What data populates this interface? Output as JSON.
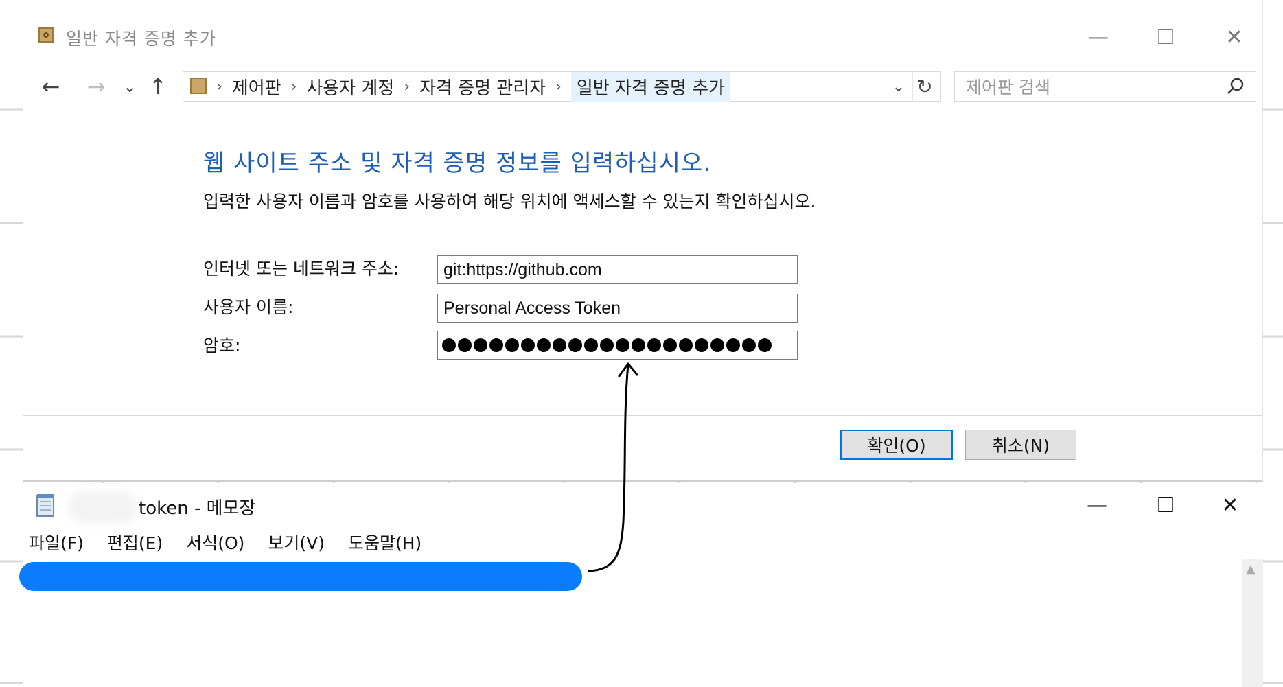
{
  "dialog": {
    "title": "일반 자격 증명 추가",
    "window_controls": {
      "minimize": "—",
      "maximize": "☐",
      "close": "✕"
    },
    "nav": {
      "back": "←",
      "forward": "→",
      "recent": "⌄",
      "up": "↑"
    },
    "breadcrumb": {
      "items": [
        "제어판",
        "사용자 계정",
        "자격 증명 관리자",
        "일반 자격 증명 추가"
      ],
      "separator": "›",
      "dropdown": "⌄",
      "refresh": "↻"
    },
    "search": {
      "placeholder": "제어판 검색"
    },
    "heading": "웹 사이트 주소 및 자격 증명 정보를 입력하십시오.",
    "subtext": "입력한 사용자 이름과 암호를 사용하여 해당 위치에 액세스할 수 있는지 확인하십시오.",
    "fields": {
      "address": {
        "label": "인터넷 또는 네트워크 주소:",
        "value": "git:https://github.com"
      },
      "username": {
        "label": "사용자 이름:",
        "value": "Personal Access Token"
      },
      "password": {
        "label": "암호:",
        "masked_dot_count": 21
      }
    },
    "buttons": {
      "ok": "확인(O)",
      "cancel": "취소(N)"
    },
    "colors": {
      "heading": "#1e5fb5",
      "primary_border": "#0078d7"
    }
  },
  "notepad": {
    "title": "token - 메모장",
    "window_controls": {
      "minimize": "—",
      "maximize": "☐",
      "close": "✕"
    },
    "menu": [
      "파일(F)",
      "편집(E)",
      "서식(O)",
      "보기(V)",
      "도움말(H)"
    ],
    "redaction_color": "#0a7cff"
  }
}
